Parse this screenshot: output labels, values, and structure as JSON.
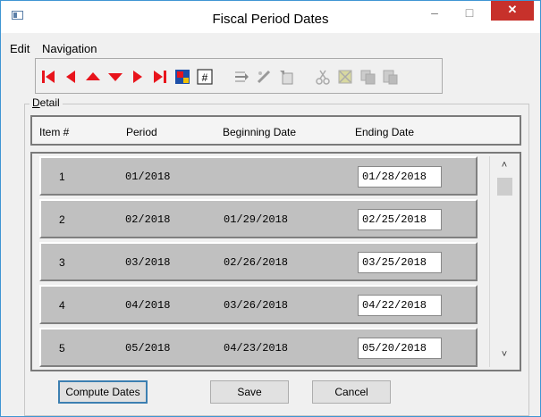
{
  "window": {
    "title": "Fiscal Period Dates",
    "minimize_glyph": "–",
    "maximize_glyph": "□",
    "close_glyph": "✕"
  },
  "menu": {
    "edit": "Edit",
    "navigation": "Navigation"
  },
  "toolbar": {
    "icons": [
      "first-record-icon",
      "previous-record-icon",
      "previous-page-icon",
      "next-page-icon",
      "next-record-icon",
      "last-record-icon",
      "find-icon",
      "goto-number-icon",
      "insert-row-icon",
      "edit-icon",
      "new-record-icon",
      "cut-icon",
      "delete-icon",
      "copy-icon",
      "paste-icon"
    ],
    "nav_color": "#e8141c"
  },
  "detail": {
    "label_prefix": "D",
    "label_rest": "etail",
    "headers": {
      "item": "Item #",
      "period": "Period",
      "beginning": "Beginning Date",
      "ending": "Ending Date"
    },
    "rows": [
      {
        "item": "1",
        "period": "01/2018",
        "beginning": "",
        "ending": "01/28/2018"
      },
      {
        "item": "2",
        "period": "02/2018",
        "beginning": "01/29/2018",
        "ending": "02/25/2018"
      },
      {
        "item": "3",
        "period": "03/2018",
        "beginning": "02/26/2018",
        "ending": "03/25/2018"
      },
      {
        "item": "4",
        "period": "04/2018",
        "beginning": "03/26/2018",
        "ending": "04/22/2018"
      },
      {
        "item": "5",
        "period": "05/2018",
        "beginning": "04/23/2018",
        "ending": "05/20/2018"
      }
    ]
  },
  "scrollbar": {
    "up_glyph": "˄",
    "down_glyph": "˅"
  },
  "buttons": {
    "compute": "Compute Dates",
    "save": "Save",
    "cancel": "Cancel"
  }
}
